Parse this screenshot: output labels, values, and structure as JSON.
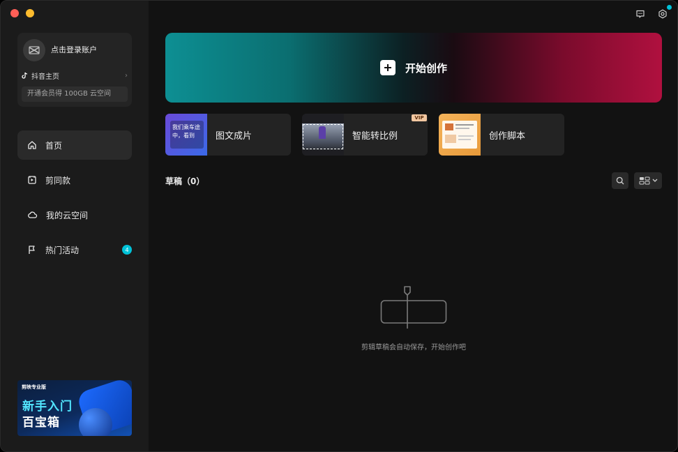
{
  "sidebar": {
    "account": {
      "login_label": "点击登录账户",
      "douyin_label": "抖音主页",
      "vip_promo": "开通会员得 100GB 云空间"
    },
    "nav": [
      {
        "label": "首页",
        "icon": "home-icon",
        "active": true
      },
      {
        "label": "剪同款",
        "icon": "template-icon"
      },
      {
        "label": "我的云空间",
        "icon": "cloud-icon"
      },
      {
        "label": "热门活动",
        "icon": "flag-icon",
        "badge": "4"
      }
    ],
    "promo": {
      "brand": "剪映专业版",
      "line1": "新手入门",
      "line2": "百宝箱"
    }
  },
  "header": {
    "icons": [
      "feedback-icon",
      "settings-icon"
    ]
  },
  "main": {
    "hero_label": "开始创作",
    "tools": [
      {
        "label": "图文成片",
        "thumb_text": "我们乘车途中，看到"
      },
      {
        "label": "智能转比例",
        "vip_tag": "VIP"
      },
      {
        "label": "创作脚本"
      }
    ],
    "drafts": {
      "title": "草稿",
      "count": "（0）",
      "empty_text": "剪辑草稿会自动保存，开始创作吧"
    }
  },
  "colors": {
    "accent": "#00c2d8",
    "vip": "#f2c7a1"
  }
}
